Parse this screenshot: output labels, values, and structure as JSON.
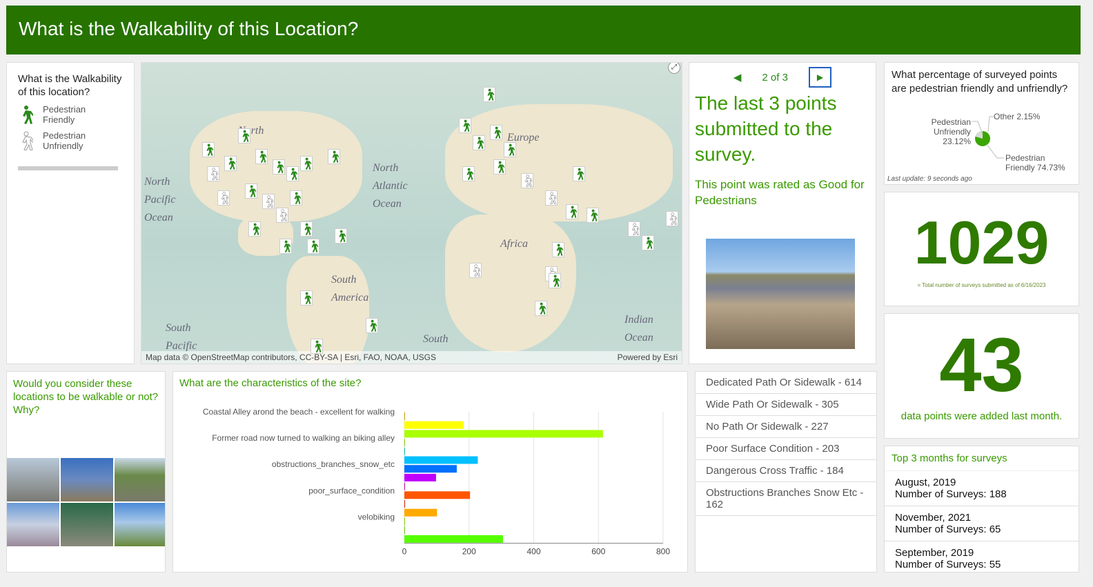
{
  "header": {
    "title": "What is the Walkability of this Location?"
  },
  "legend": {
    "title": "What is the Walkability of this location?",
    "items": [
      {
        "label": "Pedestrian Friendly",
        "icon": "walker-green-icon"
      },
      {
        "label": "Pedestrian Unfriendly",
        "icon": "walker-gray-icon"
      }
    ]
  },
  "map": {
    "attribution": "Map data © OpenStreetMap contributors, CC-BY-SA | Esri, FAO, NOAA, USGS",
    "powered": "Powered by Esri",
    "labels": [
      "North",
      "Europe",
      "North Atlantic Ocean",
      "North Pacific Ocean",
      "Africa",
      "South America",
      "South Pacific",
      "South",
      "Indian Ocean"
    ]
  },
  "details": {
    "pager": "2 of 3",
    "title": "The last 3 points submitted to the survey.",
    "rating": "This point was rated as Good for Pedestrians"
  },
  "pie": {
    "title": "What percentage of surveyed points are pedestrian friendly and unfriendly?",
    "last_update": "Last update: 9 seconds ago",
    "slices": [
      {
        "label": "Pedestrian Friendly 74.73%",
        "value": 74.73,
        "color": "#3aa600"
      },
      {
        "label": "Pedestrian Unfriendly 23.12%",
        "value": 23.12,
        "color": "#d9d9d9"
      },
      {
        "label": "Other 2.15%",
        "value": 2.15,
        "color": "#b0b0b0"
      }
    ]
  },
  "total": {
    "value": "1029",
    "caption": "= Total number of surveys submitted as of 6/16/2023"
  },
  "month_count": {
    "value": "43",
    "caption": "data points were added last month."
  },
  "question": {
    "title": "Would you consider these locations to be walkable or not?  Why?"
  },
  "chart_data": {
    "type": "bar",
    "title": "What are the characteristics of the site?",
    "orientation": "horizontal",
    "xlim": [
      0,
      800
    ],
    "xticks": [
      "0",
      "200",
      "400",
      "600",
      "800"
    ],
    "labels": [
      "Coastal Alley arond the beach - excellent for walking",
      "Former road now turned to walking an biking alley",
      "obstructions_branches_snow_etc",
      "poor_surface_condition",
      "velobiking"
    ],
    "values": [
      2,
      184,
      614,
      2,
      1,
      227,
      162,
      98,
      1,
      203,
      1,
      101,
      1,
      1,
      305
    ],
    "colors": [
      "#c8a000",
      "#ffff00",
      "#aaff00",
      "#88cc00",
      "#00c8a0",
      "#00c0ff",
      "#0070ff",
      "#c000ff",
      "#cc0099",
      "#ff5500",
      "#cc2200",
      "#ffaa00",
      "#88cc00",
      "#66cc00",
      "#55ff00"
    ],
    "grid": true
  },
  "categories": [
    "Dedicated Path Or Sidewalk - 614",
    "Wide Path Or Sidewalk - 305",
    "No Path Or Sidewalk - 227",
    "Poor Surface Condition - 203",
    "Dangerous Cross Traffic - 184",
    "Obstructions Branches Snow Etc - 162"
  ],
  "months": {
    "title": "Top 3 months for surveys",
    "items": [
      {
        "month": "August, 2019",
        "count": "Number of Surveys:  188"
      },
      {
        "month": "November, 2021",
        "count": "Number of Surveys:  65"
      },
      {
        "month": "September, 2019",
        "count": "Number of Surveys:  55"
      }
    ]
  }
}
